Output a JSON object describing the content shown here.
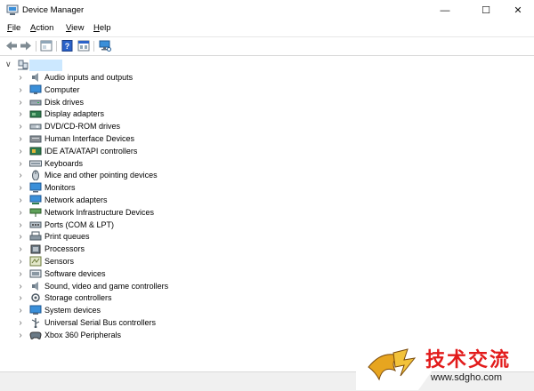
{
  "window": {
    "title": "Device Manager"
  },
  "menu": [
    {
      "pre": "",
      "accel": "F",
      "post": "ile"
    },
    {
      "pre": "",
      "accel": "A",
      "post": "ction"
    },
    {
      "pre": "",
      "accel": "V",
      "post": "iew"
    },
    {
      "pre": "",
      "accel": "H",
      "post": "elp"
    }
  ],
  "toolbar": [
    "back-arrow-icon",
    "forward-arrow-icon",
    "properties-icon",
    "help-icon",
    "device-view-icon",
    "monitor-scan-icon"
  ],
  "tree": {
    "categories": [
      {
        "label": "Audio inputs and outputs",
        "icon": "speaker-icon"
      },
      {
        "label": "Computer",
        "icon": "computer-icon"
      },
      {
        "label": "Disk drives",
        "icon": "disk-drive-icon"
      },
      {
        "label": "Display adapters",
        "icon": "display-adapter-icon"
      },
      {
        "label": "DVD/CD-ROM drives",
        "icon": "optical-drive-icon"
      },
      {
        "label": "Human Interface Devices",
        "icon": "hid-icon"
      },
      {
        "label": "IDE ATA/ATAPI controllers",
        "icon": "ide-controller-icon"
      },
      {
        "label": "Keyboards",
        "icon": "keyboard-icon"
      },
      {
        "label": "Mice and other pointing devices",
        "icon": "mouse-icon"
      },
      {
        "label": "Monitors",
        "icon": "monitor-icon"
      },
      {
        "label": "Network adapters",
        "icon": "network-adapter-icon"
      },
      {
        "label": "Network Infrastructure Devices",
        "icon": "network-infrastructure-icon"
      },
      {
        "label": "Ports (COM & LPT)",
        "icon": "port-icon"
      },
      {
        "label": "Print queues",
        "icon": "printer-icon"
      },
      {
        "label": "Processors",
        "icon": "processor-icon"
      },
      {
        "label": "Sensors",
        "icon": "sensor-icon"
      },
      {
        "label": "Software devices",
        "icon": "software-device-icon"
      },
      {
        "label": "Sound, video and game controllers",
        "icon": "sound-controller-icon"
      },
      {
        "label": "Storage controllers",
        "icon": "storage-controller-icon"
      },
      {
        "label": "System devices",
        "icon": "system-device-icon"
      },
      {
        "label": "Universal Serial Bus controllers",
        "icon": "usb-icon"
      },
      {
        "label": "Xbox 360 Peripherals",
        "icon": "gamepad-icon"
      }
    ]
  },
  "watermark": {
    "text": "技术交流",
    "url": "www.sdgho.com"
  },
  "colors": {
    "selection": "#cce8ff",
    "watermark_red": "#e21b1b"
  }
}
